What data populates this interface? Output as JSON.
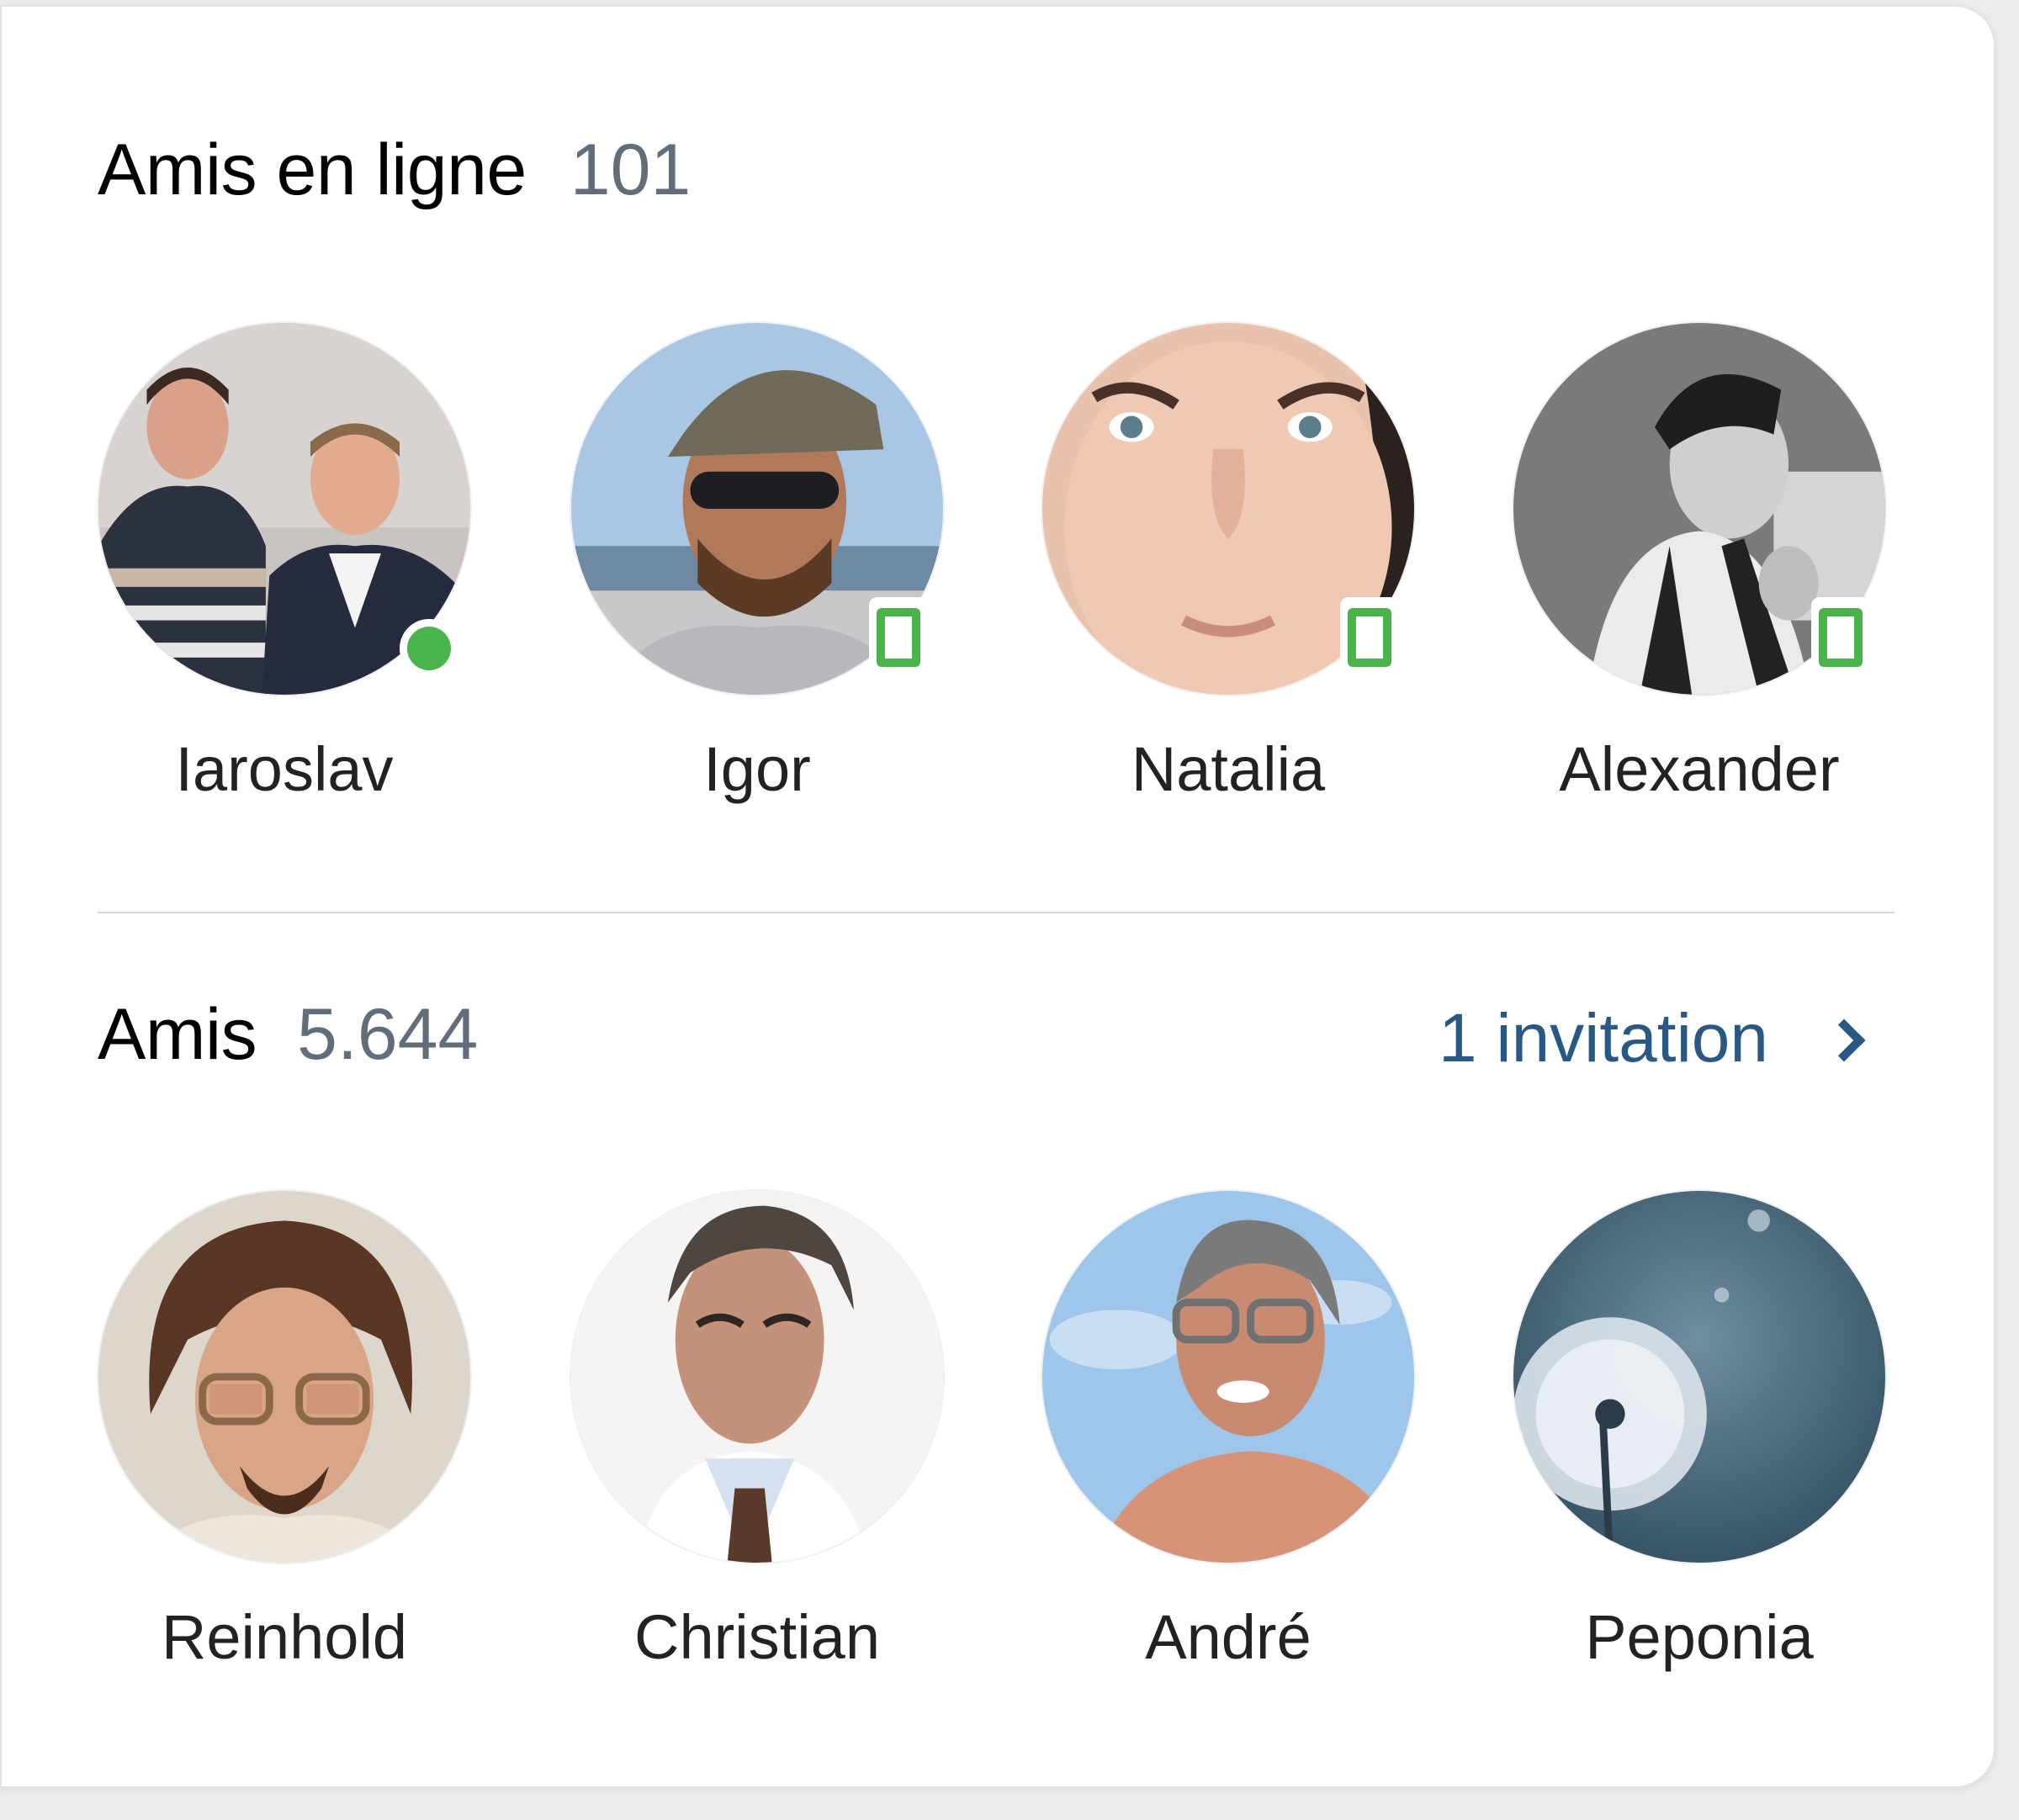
{
  "online": {
    "title": "Amis en ligne",
    "count": "101",
    "friends": [
      {
        "name": "Iaroslav",
        "status": "online-dot"
      },
      {
        "name": "Igor",
        "status": "mobile"
      },
      {
        "name": "Natalia",
        "status": "mobile"
      },
      {
        "name": "Alexander",
        "status": "mobile"
      }
    ]
  },
  "friends": {
    "title": "Amis",
    "count": "5.644",
    "invitation_label": "1 invitation",
    "list": [
      {
        "name": "Reinhold"
      },
      {
        "name": "Christian"
      },
      {
        "name": "André"
      },
      {
        "name": "Peponia"
      }
    ]
  },
  "colors": {
    "online_green": "#4bb34b",
    "link_blue": "#2a5885",
    "count_gray": "#626d7a"
  }
}
